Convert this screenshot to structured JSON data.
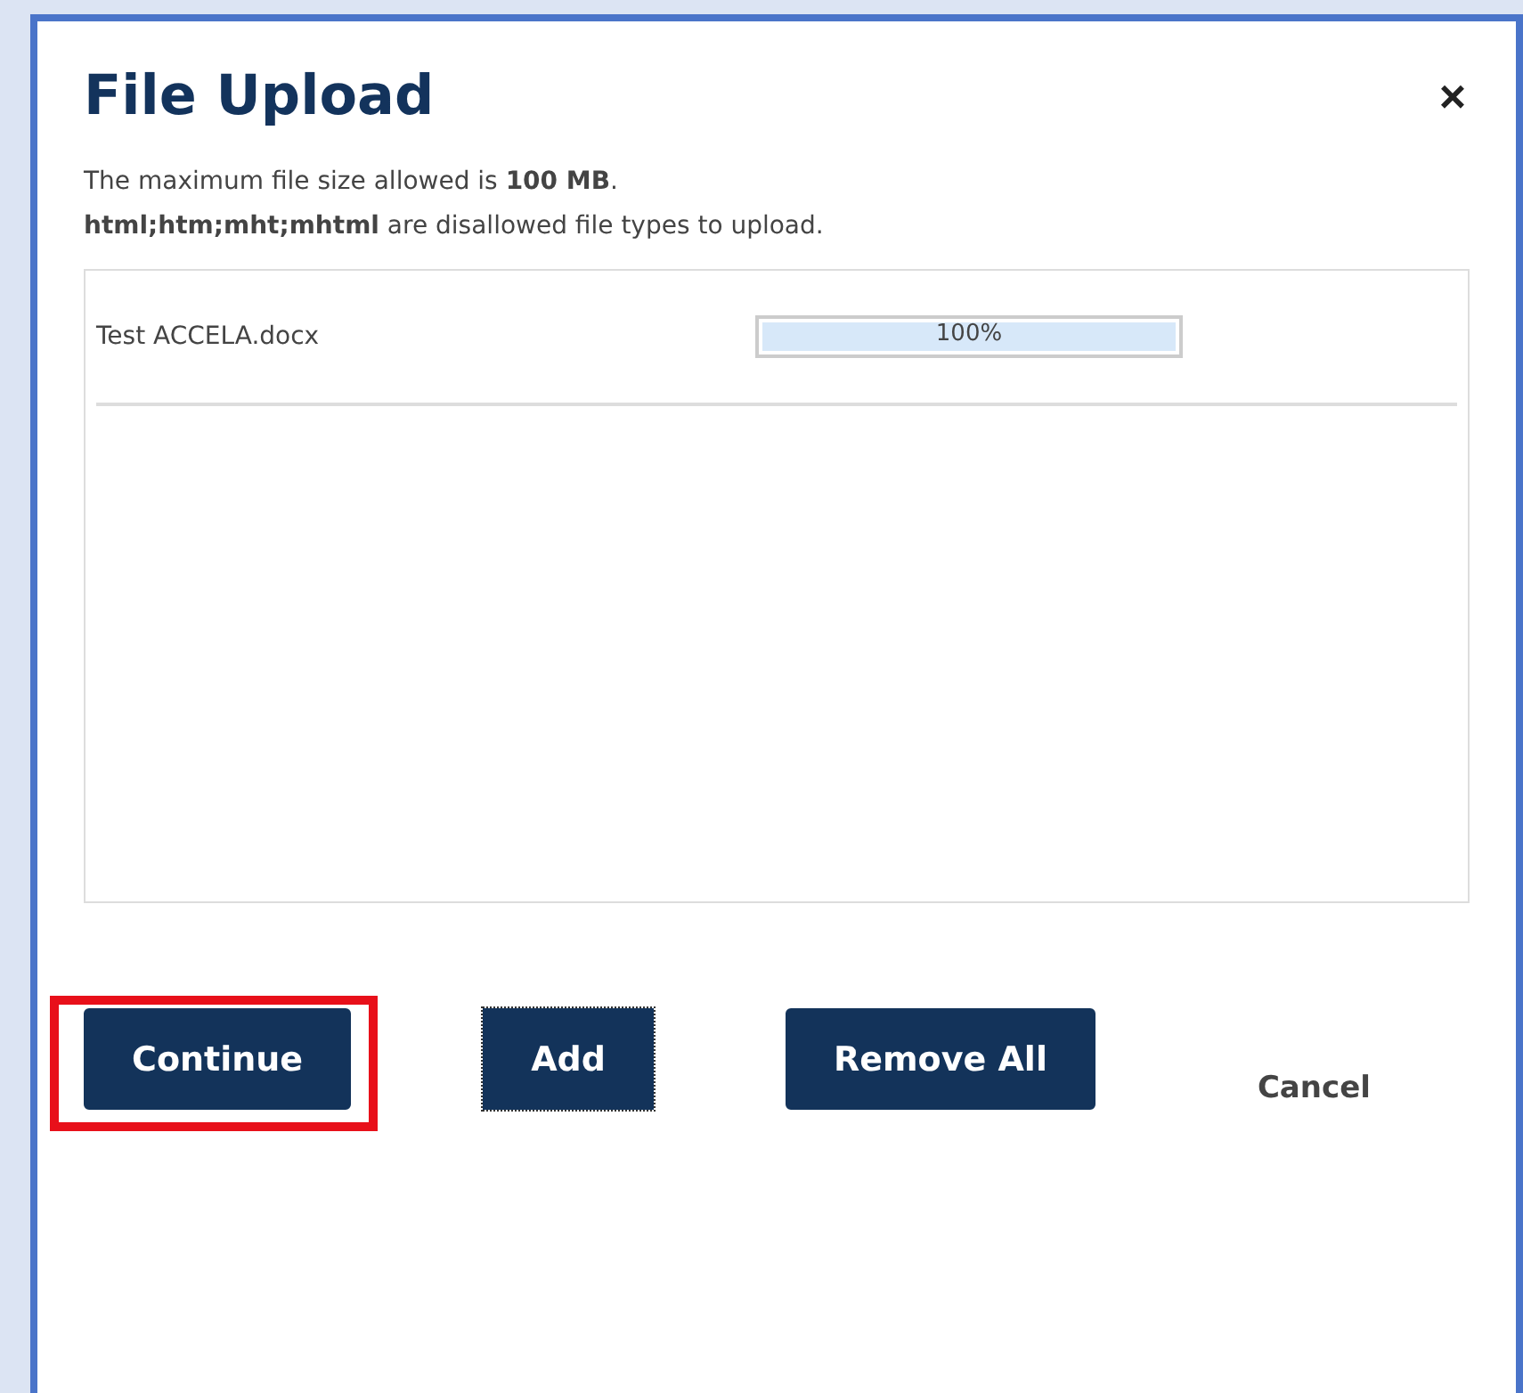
{
  "dialog": {
    "title": "File Upload",
    "close": "×"
  },
  "notes": [
    "The maximum file size allowed is **100 MB**.",
    "**html;htm;mht;mhtml** are disallowed file types to upload."
  ],
  "files": [
    {
      "name": "Test ACCELA.docx",
      "level": 1,
      "reading": "100%"
    }
  ],
  "buttons": [
    {
      "label": "Continue",
      "kind": "primary",
      "focused": false,
      "highlighted": true
    },
    {
      "label": "Add",
      "kind": "primary",
      "focused": true,
      "highlighted": false
    },
    {
      "label": "Remove All",
      "kind": "primary",
      "focused": false,
      "highlighted": false
    },
    {
      "label": "Cancel",
      "kind": "link",
      "focused": false,
      "highlighted": false
    }
  ]
}
